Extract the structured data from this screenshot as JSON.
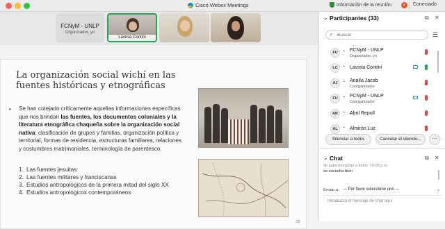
{
  "titlebar": {
    "app_title": "Cisco Webex Meetings",
    "info_link": "Información de la reunión",
    "status": "Conectado"
  },
  "thumbnails": {
    "name_tile": {
      "title": "FCNyM - UNLP",
      "subtitle": "Organizador, yo"
    },
    "camera_label": "Lavinia Contini"
  },
  "slide": {
    "title": "La organización social wichí en las fuentes históricas y etnográficas",
    "bullet_parts": [
      {
        "text": "Se han cotejado críticamente aquellas informaciones específicas que nos brindan ",
        "bold": false
      },
      {
        "text": "las fuentes, los documentos coloniales y la literatura etnográfica chaqueña sobre la organización social nativa",
        "bold": true
      },
      {
        "text": ": clasificación de grupos y familias, organización política y territorial, formas de residencia, estructuras familiares, relaciones y costumbres matrimoniales, terminología de parentesco.",
        "bold": false
      }
    ],
    "numbered": [
      {
        "num": "1.",
        "text": "Las fuentes jesuitas"
      },
      {
        "num": "2.",
        "text": "Las fuentes militares y franciscanas"
      },
      {
        "num": "3.",
        "text": "Estudios antropológicos de la primera mitad del siglo XX"
      },
      {
        "num": "4.",
        "text": "Estudios antropológicos contemporáneos"
      }
    ],
    "page_number": "20"
  },
  "participants": {
    "header": "Participantes (33)",
    "search_placeholder": "Buscar",
    "list": [
      {
        "initials": "FU",
        "name": "FCNyM - UNLP",
        "role": "Organizador, yo",
        "camera": false,
        "mic": "muted"
      },
      {
        "initials": "LC",
        "name": "Lavinia Contini",
        "role": "",
        "camera": true,
        "mic": "on"
      },
      {
        "initials": "AJ",
        "name": "Analía Jacob",
        "role": "Coorganizador",
        "camera": false,
        "mic": "muted"
      },
      {
        "initials": "FU",
        "name": "FCNyM - UNLP",
        "role": "Coorganizador",
        "camera": true,
        "mic": "muted"
      },
      {
        "initials": "AR",
        "name": "Abril Repoll",
        "role": "",
        "camera": false,
        "mic": "muted"
      },
      {
        "initials": "AL",
        "name": "Almirón Luz",
        "role": "",
        "camera": false,
        "mic": "muted"
      }
    ],
    "mute_all_button": "Silenciar a todos",
    "cancel_mute_button": "Cancelar el silencio..."
  },
  "chat": {
    "header": "Chat",
    "partial_line": "de gaby morgante a todos: 10:08 p.m.",
    "message": "se escucha bien",
    "send_label": "Enviar a:",
    "send_to": "--- Por favor seleccione uno ---",
    "compose_placeholder": "Introduzca el mensaje de chat aquí"
  },
  "colors": {
    "active_speaker_border": "#1fa64f",
    "muted_mic": "#dd4444",
    "camera_icon": "#1a8fd6",
    "record_badge": "#e8522b"
  }
}
